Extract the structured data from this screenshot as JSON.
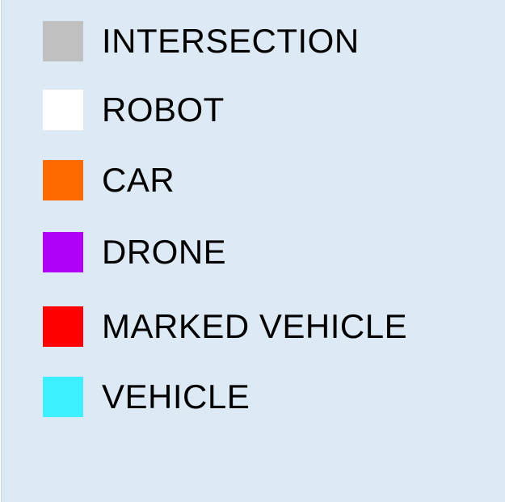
{
  "legend": {
    "items": [
      {
        "label": "INTERSECTION",
        "color": "#c0c0c0"
      },
      {
        "label": "ROBOT",
        "color": "#ffffff"
      },
      {
        "label": "CAR",
        "color": "#ff6a00"
      },
      {
        "label": "DRONE",
        "color": "#b000f5"
      },
      {
        "label": "MARKED VEHICLE",
        "color": "#ff0000"
      },
      {
        "label": "VEHICLE",
        "color": "#3cf0ff"
      }
    ]
  }
}
